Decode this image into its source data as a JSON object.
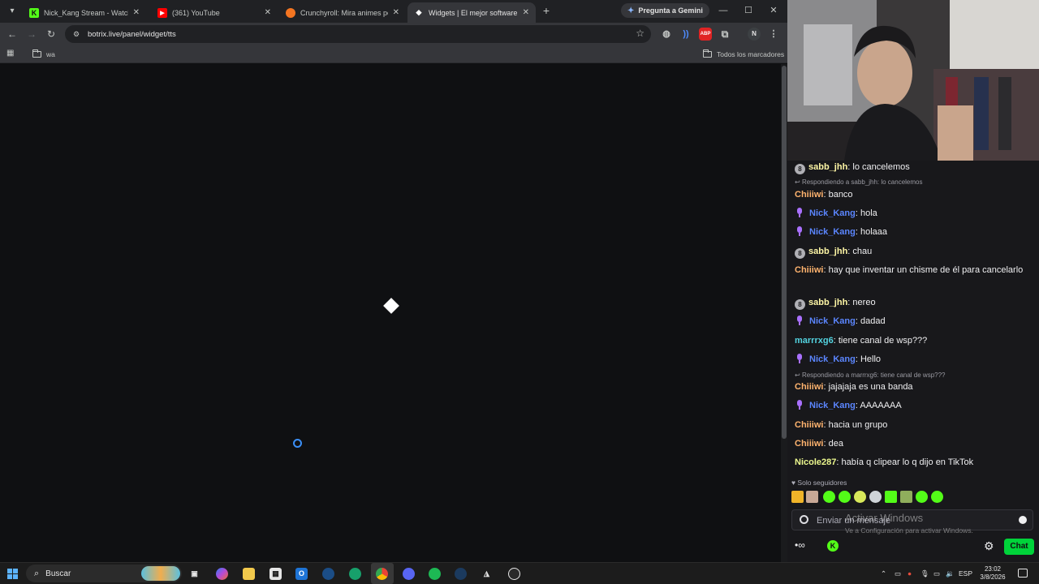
{
  "browser": {
    "tabs": [
      {
        "title": "Nick_Kang Stream - Watch Live",
        "favicon": "kick-icon",
        "color": "#53fc18",
        "active": false
      },
      {
        "title": "(361) YouTube",
        "favicon": "youtube-icon",
        "color": "#ff0000",
        "active": false
      },
      {
        "title": "Crunchyroll: Mira animes popu",
        "favicon": "crunchyroll-icon",
        "color": "#f47521",
        "active": false
      },
      {
        "title": "Widgets | El mejor software pa",
        "favicon": "botrix-icon",
        "color": "#ffffff",
        "active": true
      }
    ],
    "gemini_label": "Pregunta a Gemini",
    "url": "botrix.live/panel/widget/tts",
    "profile_initial": "N",
    "bookmarks": {
      "folder": "wa",
      "all_bookmarks": "Todos los marcadores"
    }
  },
  "chat": {
    "messages": [
      {
        "badge": "8",
        "user": "sabb_jhh",
        "text": "lo cancelemos",
        "color": "#fff7a6"
      },
      {
        "reply": "Respondiendo a sabb_jhh: lo cancelemos"
      },
      {
        "user": "Chiiiwi",
        "text": "banco",
        "color": "#ffb36e"
      },
      {
        "mic": true,
        "user": "Nick_Kang",
        "text": "hola",
        "color": "#5b86ff"
      },
      {
        "mic": true,
        "user": "Nick_Kang",
        "text": "holaaa",
        "color": "#5b86ff"
      },
      {
        "badge": "8",
        "user": "sabb_jhh",
        "text": "chau",
        "color": "#fff7a6"
      },
      {
        "user": "Chiiiwi",
        "text": "hay que inventar un chisme de él para cancelarlo",
        "color": "#ffb36e"
      },
      {
        "badge": "8",
        "user": "sabb_jhh",
        "text": "nereo",
        "color": "#fff7a6"
      },
      {
        "mic": true,
        "user": "Nick_Kang",
        "text": "dadad",
        "color": "#5b86ff"
      },
      {
        "user": "marrrxg6",
        "text": "tiene canal de wsp???",
        "color": "#53d3e0"
      },
      {
        "mic": true,
        "user": "Nick_Kang",
        "text": "Hello",
        "color": "#5b86ff"
      },
      {
        "reply": "Respondiendo a marrrxg6: tiene canal de wsp???"
      },
      {
        "user": "Chiiiwi",
        "text": "jajajaja es una banda",
        "color": "#ffb36e"
      },
      {
        "mic": true,
        "user": "Nick_Kang",
        "text": "AAAAAAA",
        "color": "#5b86ff"
      },
      {
        "user": "Chiiiwi",
        "text": "hacia un grupo",
        "color": "#ffb36e"
      },
      {
        "user": "Chiiiwi",
        "text": "dea",
        "color": "#ffb36e"
      },
      {
        "user": "Nicole287",
        "text": "había q clipear lo q dijo en TikTok",
        "color": "#ecf88e"
      }
    ],
    "followers_only": "Solo seguidores",
    "input_placeholder": "Enviar un mensaje",
    "send_label": "Chat",
    "accent": "#00d33a"
  },
  "windows_activation": {
    "title": "Activar Windows",
    "subtitle": "Ve a Configuración para activar Windows."
  },
  "taskbar": {
    "search_label": "Buscar",
    "language": "ESP",
    "time": "23:02",
    "date": "3/8/2026"
  }
}
